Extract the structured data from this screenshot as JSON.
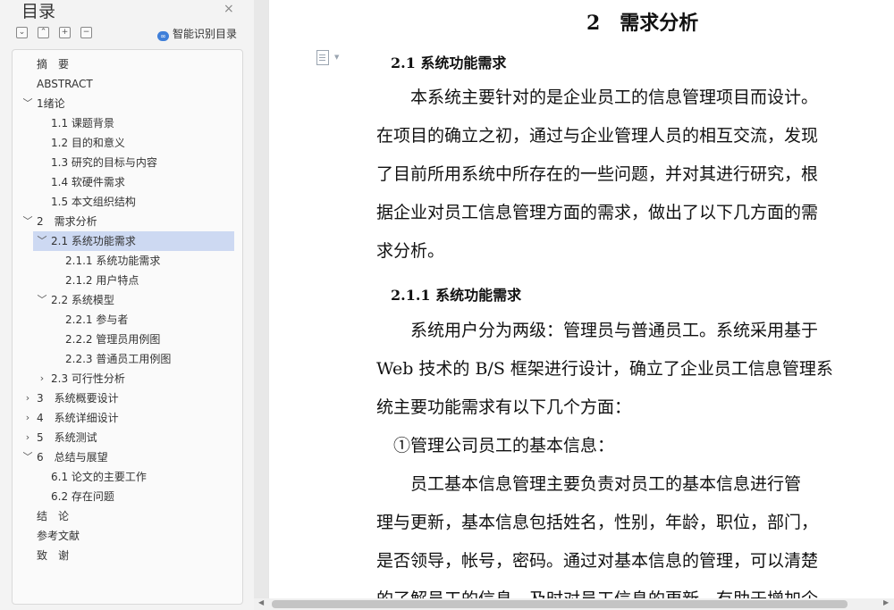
{
  "toc": {
    "title": "目录",
    "close_icon": "×",
    "smart_label": "智能识别目录",
    "items": [
      {
        "label": "摘　要",
        "chev": ""
      },
      {
        "label": "ABSTRACT",
        "chev": ""
      },
      {
        "label": "1绪论",
        "chev": "﹀"
      },
      {
        "label": "1.1 课题背景",
        "chev": ""
      },
      {
        "label": "1.2 目的和意义",
        "chev": ""
      },
      {
        "label": "1.3 研究的目标与内容",
        "chev": ""
      },
      {
        "label": "1.4 软硬件需求",
        "chev": ""
      },
      {
        "label": "1.5 本文组织结构",
        "chev": ""
      },
      {
        "label": "2　需求分析",
        "chev": "﹀"
      },
      {
        "label": "2.1 系统功能需求",
        "chev": "﹀",
        "selected": true
      },
      {
        "label": "2.1.1 系统功能需求",
        "chev": ""
      },
      {
        "label": "2.1.2 用户特点",
        "chev": ""
      },
      {
        "label": "2.2 系统模型",
        "chev": "﹀"
      },
      {
        "label": "2.2.1 参与者",
        "chev": ""
      },
      {
        "label": "2.2.2 管理员用例图",
        "chev": ""
      },
      {
        "label": "2.2.3 普通员工用例图",
        "chev": ""
      },
      {
        "label": "2.3 可行性分析",
        "chev": "›"
      },
      {
        "label": "3　系统概要设计",
        "chev": "›"
      },
      {
        "label": "4　系统详细设计",
        "chev": "›"
      },
      {
        "label": "5　系统测试",
        "chev": "›"
      },
      {
        "label": "6　总结与展望",
        "chev": "﹀"
      },
      {
        "label": "6.1 论文的主要工作",
        "chev": ""
      },
      {
        "label": "6.2 存在问题",
        "chev": ""
      },
      {
        "label": "结　论",
        "chev": ""
      },
      {
        "label": "参考文献",
        "chev": ""
      },
      {
        "label": "致　谢",
        "chev": ""
      }
    ]
  },
  "document": {
    "heading": "2　需求分析",
    "section_2_1": "2.1 系统功能需求",
    "para1": [
      "　　本系统主要针对的是企业员工的信息管理项目而设计。",
      "在项目的确立之初，通过与企业管理人员的相互交流，发现",
      "了目前所用系统中所存在的一些问题，并对其进行研究，根",
      "据企业对员工信息管理方面的需求，做出了以下几方面的需",
      "求分析。"
    ],
    "section_2_1_1": "2.1.1 系统功能需求",
    "para2": [
      "　　系统用户分为两级：管理员与普通员工。系统采用基于",
      "Web 技术的 B/S 框架进行设计，确立了企业员工信息管理系",
      "统主要功能需求有以下几个方面："
    ],
    "item1": "　①管理公司员工的基本信息：",
    "para3": [
      "　　员工基本信息管理主要负责对员工的基本信息进行管",
      "理与更新，基本信息包括姓名，性别，年龄，职位，部门，",
      "是否领导，帐号，密码。通过对基本信息的管理，可以清楚",
      "的了解员工的信息，及时对员工信息的更新，有助于增加企"
    ]
  }
}
